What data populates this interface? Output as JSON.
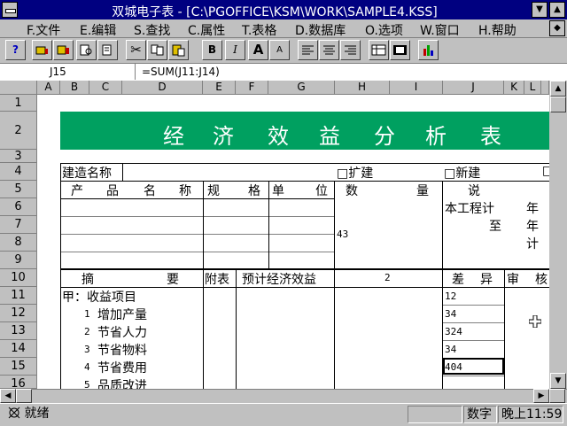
{
  "window": {
    "title": "双城电子表 - [C:\\PGOFFICE\\KSM\\WORK\\SAMPLE4.KSS]",
    "min_glyph": "▼",
    "max_glyph": "▲",
    "restore_glyph": "◆"
  },
  "menu": [
    "F.文件",
    "E.编辑",
    "S.查找",
    "C.属性",
    "T.表格",
    "D.数据库",
    "O.选项",
    "W.窗口",
    "H.帮助"
  ],
  "toolbar": {
    "help": "?",
    "cut": "✂",
    "bold": "B",
    "italic": "I",
    "font_large": "A",
    "font_small": "A"
  },
  "formula_bar": {
    "cell_ref": "J15",
    "formula": "=SUM(J11:J14)"
  },
  "columns": [
    "A",
    "B",
    "C",
    "D",
    "E",
    "F",
    "G",
    "H",
    "I",
    "J",
    "K",
    "L"
  ],
  "rows": [
    "1",
    "2",
    "3",
    "4",
    "5",
    "6",
    "7",
    "8",
    "9",
    "10",
    "11",
    "12",
    "13",
    "14",
    "15",
    "16"
  ],
  "banner": [
    "经",
    "济",
    "效",
    "益",
    "分",
    "析",
    "表"
  ],
  "sheet": {
    "construction_name": "建造名称",
    "expand": "□扩建",
    "new_build": "□新建",
    "box_partial": "□",
    "product": [
      "产",
      "品",
      "名",
      "称"
    ],
    "spec": [
      "规",
      "格"
    ],
    "unit": [
      "单",
      "位"
    ],
    "qty": [
      "数",
      "量"
    ],
    "explain": "说",
    "plan_label": "本工程计",
    "year1": "年",
    "to": "至",
    "year2": "年",
    "calc": "计",
    "h8": "43",
    "summary": [
      "摘",
      "要"
    ],
    "appendix": "附表",
    "expected": "预计经济效益",
    "num2": "2",
    "diff": [
      "差",
      "异"
    ],
    "audit": [
      "审",
      "核"
    ],
    "items": [
      "甲：收益项目",
      "1",
      "增加产量",
      "2",
      "节省人力",
      "3",
      "节省物料",
      "4",
      "节省费用",
      "5",
      "品质改进"
    ],
    "j_values": [
      "12",
      "34",
      "324",
      "34",
      "404"
    ]
  },
  "status": {
    "ready": "就绪",
    "mode": "数字",
    "time": "晚上11:59"
  }
}
